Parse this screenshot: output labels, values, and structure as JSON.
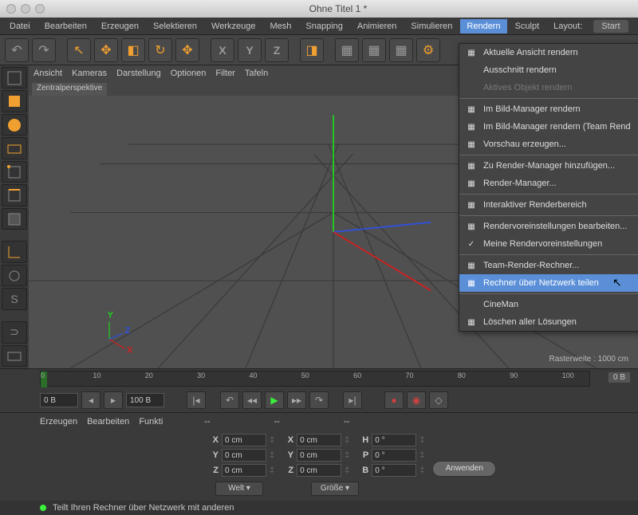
{
  "window": {
    "title": "Ohne Titel 1 *"
  },
  "menubar": {
    "items": [
      "Datei",
      "Bearbeiten",
      "Erzeugen",
      "Selektieren",
      "Werkzeuge",
      "Mesh",
      "Snapping",
      "Animieren",
      "Simulieren",
      "Rendern",
      "Sculpt",
      "Layout:"
    ],
    "start": "Start",
    "active_index": 9
  },
  "viewport": {
    "menus": [
      "Ansicht",
      "Kameras",
      "Darstellung",
      "Optionen",
      "Filter",
      "Tafeln"
    ],
    "label": "Zentralperspektive",
    "grid_info": "Rasterweite : 1000 cm",
    "axes": {
      "x": "X",
      "y": "Y",
      "z": "Z"
    }
  },
  "timeline": {
    "ticks": [
      "0",
      "10",
      "20",
      "30",
      "40",
      "50",
      "60",
      "70",
      "80",
      "90",
      "100"
    ],
    "start": "0 B",
    "end": "100 B",
    "current": "0 B"
  },
  "coord": {
    "tabs": [
      "Erzeugen",
      "Bearbeiten",
      "Funkti"
    ],
    "header": [
      "--",
      "--",
      "--"
    ],
    "rows": [
      {
        "label": "X",
        "pos": "0 cm",
        "size": "0 cm",
        "rot_label": "H",
        "rot": "0 °"
      },
      {
        "label": "Y",
        "pos": "0 cm",
        "size": "0 cm",
        "rot_label": "P",
        "rot": "0 °"
      },
      {
        "label": "Z",
        "pos": "0 cm",
        "size": "0 cm",
        "rot_label": "B",
        "rot": "0 °"
      }
    ],
    "sel1": "Welt",
    "sel2": "Größe",
    "apply": "Anwenden"
  },
  "status": {
    "text": "Teilt Ihren Rechner über Netzwerk mit anderen"
  },
  "render_menu": {
    "items": [
      {
        "label": "Aktuelle Ansicht rendern",
        "icon": "▦"
      },
      {
        "label": "Ausschnitt rendern"
      },
      {
        "label": "Aktives Objekt rendern",
        "disabled": true
      },
      {
        "sep": true
      },
      {
        "label": "Im Bild-Manager rendern",
        "icon": "▦"
      },
      {
        "label": "Im Bild-Manager rendern (Team Rend",
        "icon": "▦"
      },
      {
        "label": "Vorschau erzeugen...",
        "icon": "▦"
      },
      {
        "sep": true
      },
      {
        "label": "Zu Render-Manager hinzufügen...",
        "icon": "▦"
      },
      {
        "label": "Render-Manager...",
        "icon": "▦"
      },
      {
        "sep": true
      },
      {
        "label": "Interaktiver Renderbereich",
        "icon": "▦"
      },
      {
        "sep": true
      },
      {
        "label": "Rendervoreinstellungen bearbeiten...",
        "icon": "▦"
      },
      {
        "label": "Meine Rendervoreinstellungen",
        "icon": "✓"
      },
      {
        "sep": true
      },
      {
        "label": "Team-Render-Rechner...",
        "icon": "▦"
      },
      {
        "label": "Rechner über Netzwerk teilen",
        "icon": "▦",
        "highlight": true
      },
      {
        "sep": true
      },
      {
        "label": "CineMan"
      },
      {
        "label": "Löschen aller Lösungen",
        "icon": "▦"
      }
    ]
  }
}
